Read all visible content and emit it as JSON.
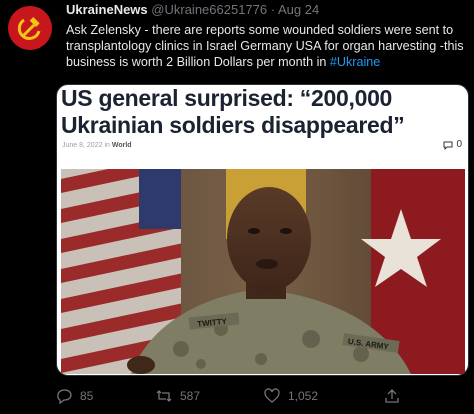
{
  "tweet": {
    "author_name": "UkraineNews",
    "handle": "@Ukraine66251776",
    "separator": "·",
    "date": "Aug 24",
    "text": "Ask Zelensky - there are reports some wounded soldiers were sent to transplantology clinics in Israel Germany USA for organ harvesting  -this business is worth 2 Billion Dollars per month in ",
    "hashtag": "#Ukraine"
  },
  "card": {
    "headline": "US general surprised: “200,000 Ukrainian soldiers disappeared”",
    "date": "June 8, 2022",
    "in_label": "in",
    "category": "World",
    "comment_count": "0",
    "uniform_nametape": "TWITTY",
    "uniform_tape": "U.S. ARMY"
  },
  "actions": {
    "replies": "85",
    "retweets": "587",
    "likes": "1,052"
  },
  "icons": {
    "avatar": "hammer-sickle-icon",
    "comment": "comment-bubble-icon",
    "reply": "reply-icon",
    "retweet": "retweet-icon",
    "like": "heart-icon",
    "share": "share-icon"
  },
  "colors": {
    "background": "#000000",
    "link": "#1d9bf0",
    "muted": "#71767b",
    "avatar": "#c8161d"
  }
}
